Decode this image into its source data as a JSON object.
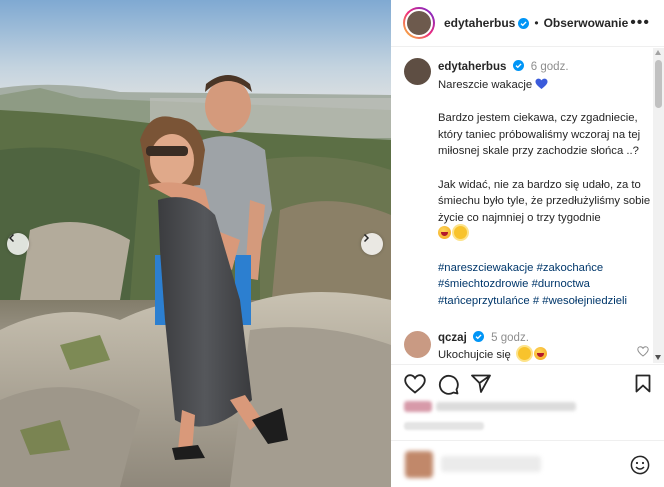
{
  "post": {
    "username": "edytaherbus",
    "follow_label": "Obserwowanie",
    "dot": "•",
    "more_label": "•••"
  },
  "caption": {
    "username": "edytaherbus",
    "time": "6 godz.",
    "line1": "Nareszcie wakacje",
    "line2": "Bardzo jestem ciekawa, czy zgadniecie, który taniec próbowaliśmy wczoraj na tej miłosnej skale przy zachodzie słońca ..?",
    "line3": "Jak widać, nie za bardzo się udało, za to śmiechu było tyle, że przedłużyliśmy sobie życie co najmniej o trzy tygodnie",
    "hashtags": [
      "#nareszciewakacje",
      "#zakochańce",
      "#śmiechtozdrowie",
      "#durnoctwa",
      "#tańceprzytulańce",
      "#",
      "#wesołejniedzieli"
    ]
  },
  "comment": {
    "username": "qczaj",
    "time": "5 godz.",
    "text": "Ukochujcie się"
  },
  "icons": {
    "like": "heart-icon",
    "comment": "comment-icon",
    "share": "share-icon",
    "save": "bookmark-icon",
    "emoji": "emoji-icon",
    "verified": "verified-badge-icon"
  },
  "colors": {
    "text": "#262626",
    "secondary": "#8e8e8e",
    "hashtag": "#00376b",
    "verified": "#0095f6",
    "heart_emoji": "#3b5bdb"
  }
}
